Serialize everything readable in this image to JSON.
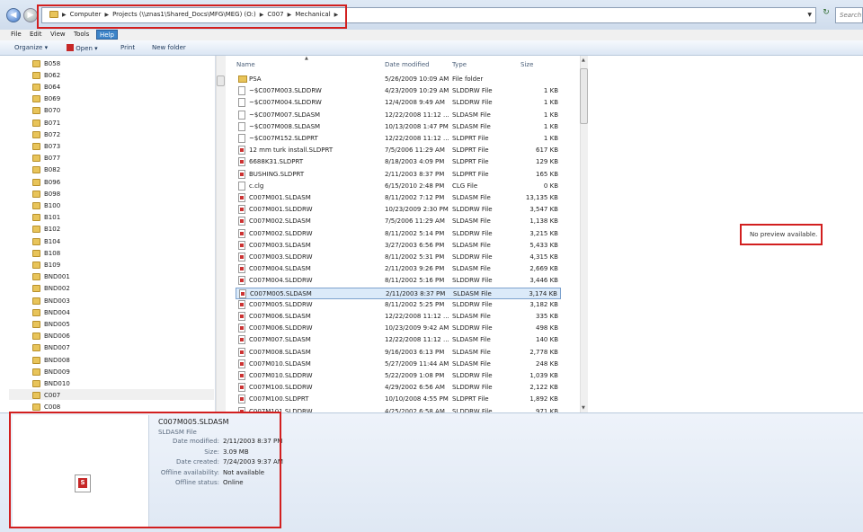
{
  "address": {
    "crumbs": [
      "Computer",
      "Projects (\\\\znas1\\Shared_Docs\\MFG\\MEG) (O:)",
      "C007",
      "Mechanical"
    ],
    "search_placeholder": "Search"
  },
  "menu": [
    "File",
    "Edit",
    "View",
    "Tools",
    "Help"
  ],
  "toolbar": {
    "organize": "Organize",
    "open": "Open",
    "print": "Print",
    "new_folder": "New folder"
  },
  "nav_folders": [
    "B058",
    "B062",
    "B064",
    "B069",
    "B070",
    "B071",
    "B072",
    "B073",
    "B077",
    "B082",
    "B096",
    "B098",
    "B100",
    "B101",
    "B102",
    "B104",
    "B108",
    "B109",
    "BND001",
    "BND002",
    "BND003",
    "BND004",
    "BND005",
    "BND006",
    "BND007",
    "BND008",
    "BND009",
    "BND010",
    "C007",
    "C008"
  ],
  "columns": {
    "name": "Name",
    "date": "Date modified",
    "type": "Type",
    "size": "Size"
  },
  "files": [
    {
      "name": "PSA",
      "date": "5/26/2009 10:09 AM",
      "type": "File folder",
      "size": "",
      "icon": "folder"
    },
    {
      "name": "~$C007M003.SLDDRW",
      "date": "4/23/2009 10:29 AM",
      "type": "SLDDRW File",
      "size": "1 KB",
      "icon": "generic"
    },
    {
      "name": "~$C007M004.SLDDRW",
      "date": "12/4/2008 9:49 AM",
      "type": "SLDDRW File",
      "size": "1 KB",
      "icon": "generic"
    },
    {
      "name": "~$C007M007.SLDASM",
      "date": "12/22/2008 11:12 ...",
      "type": "SLDASM File",
      "size": "1 KB",
      "icon": "generic"
    },
    {
      "name": "~$C007M008.SLDASM",
      "date": "10/13/2008 1:47 PM",
      "type": "SLDASM File",
      "size": "1 KB",
      "icon": "generic"
    },
    {
      "name": "~$C007M152.SLDPRT",
      "date": "12/22/2008 11:12 ...",
      "type": "SLDPRT File",
      "size": "1 KB",
      "icon": "generic"
    },
    {
      "name": "12 mm turk install.SLDPRT",
      "date": "7/5/2006 11:29 AM",
      "type": "SLDPRT File",
      "size": "617 KB",
      "icon": "sw"
    },
    {
      "name": "6688K31.SLDPRT",
      "date": "8/18/2003 4:09 PM",
      "type": "SLDPRT File",
      "size": "129 KB",
      "icon": "sw"
    },
    {
      "name": "BUSHING.SLDPRT",
      "date": "2/11/2003 8:37 PM",
      "type": "SLDPRT File",
      "size": "165 KB",
      "icon": "sw"
    },
    {
      "name": "c.clg",
      "date": "6/15/2010 2:48 PM",
      "type": "CLG File",
      "size": "0 KB",
      "icon": "generic"
    },
    {
      "name": "C007M001.SLDASM",
      "date": "8/11/2002 7:12 PM",
      "type": "SLDASM File",
      "size": "13,135 KB",
      "icon": "sw"
    },
    {
      "name": "C007M001.SLDDRW",
      "date": "10/23/2009 2:30 PM",
      "type": "SLDDRW File",
      "size": "3,547 KB",
      "icon": "sw"
    },
    {
      "name": "C007M002.SLDASM",
      "date": "7/5/2006 11:29 AM",
      "type": "SLDASM File",
      "size": "1,138 KB",
      "icon": "sw"
    },
    {
      "name": "C007M002.SLDDRW",
      "date": "8/11/2002 5:14 PM",
      "type": "SLDDRW File",
      "size": "3,215 KB",
      "icon": "sw"
    },
    {
      "name": "C007M003.SLDASM",
      "date": "3/27/2003 6:56 PM",
      "type": "SLDASM File",
      "size": "5,433 KB",
      "icon": "sw"
    },
    {
      "name": "C007M003.SLDDRW",
      "date": "8/11/2002 5:31 PM",
      "type": "SLDDRW File",
      "size": "4,315 KB",
      "icon": "sw"
    },
    {
      "name": "C007M004.SLDASM",
      "date": "2/11/2003 9:26 PM",
      "type": "SLDASM File",
      "size": "2,669 KB",
      "icon": "sw"
    },
    {
      "name": "C007M004.SLDDRW",
      "date": "8/11/2002 5:16 PM",
      "type": "SLDDRW File",
      "size": "3,446 KB",
      "icon": "sw"
    },
    {
      "name": "C007M005.SLDASM",
      "date": "2/11/2003 8:37 PM",
      "type": "SLDASM File",
      "size": "3,174 KB",
      "icon": "sw",
      "selected": true
    },
    {
      "name": "C007M005.SLDDRW",
      "date": "8/11/2002 5:25 PM",
      "type": "SLDDRW File",
      "size": "3,182 KB",
      "icon": "sw"
    },
    {
      "name": "C007M006.SLDASM",
      "date": "12/22/2008 11:12 ...",
      "type": "SLDASM File",
      "size": "335 KB",
      "icon": "sw"
    },
    {
      "name": "C007M006.SLDDRW",
      "date": "10/23/2009 9:42 AM",
      "type": "SLDDRW File",
      "size": "498 KB",
      "icon": "sw"
    },
    {
      "name": "C007M007.SLDASM",
      "date": "12/22/2008 11:12 ...",
      "type": "SLDASM File",
      "size": "140 KB",
      "icon": "sw"
    },
    {
      "name": "C007M008.SLDASM",
      "date": "9/16/2003 6:13 PM",
      "type": "SLDASM File",
      "size": "2,778 KB",
      "icon": "sw"
    },
    {
      "name": "C007M010.SLDASM",
      "date": "5/27/2009 11:44 AM",
      "type": "SLDASM File",
      "size": "248 KB",
      "icon": "sw"
    },
    {
      "name": "C007M010.SLDDRW",
      "date": "5/22/2009 1:08 PM",
      "type": "SLDDRW File",
      "size": "1,039 KB",
      "icon": "sw"
    },
    {
      "name": "C007M100.SLDDRW",
      "date": "4/29/2002 6:56 AM",
      "type": "SLDDRW File",
      "size": "2,122 KB",
      "icon": "sw"
    },
    {
      "name": "C007M100.SLDPRT",
      "date": "10/10/2008 4:55 PM",
      "type": "SLDPRT File",
      "size": "1,892 KB",
      "icon": "sw"
    },
    {
      "name": "C007M101.SLDDRW",
      "date": "4/25/2002 6:58 AM",
      "type": "SLDDRW File",
      "size": "971 KB",
      "icon": "sw"
    }
  ],
  "preview": {
    "text": "No preview available."
  },
  "details": {
    "name": "C007M005.SLDASM",
    "type": "SLDASM File",
    "fields": [
      {
        "label": "Date modified:",
        "value": "2/11/2003 8:37 PM"
      },
      {
        "label": "Size:",
        "value": "3.09 MB"
      },
      {
        "label": "Date created:",
        "value": "7/24/2003 9:37 AM"
      },
      {
        "label": "Offline availability:",
        "value": "Not available"
      },
      {
        "label": "Offline status:",
        "value": "Online"
      }
    ]
  },
  "colors": {
    "highlight_box": "#d21f1f",
    "selection": "#dbeaf9",
    "menu_active": "#3d84c8"
  }
}
